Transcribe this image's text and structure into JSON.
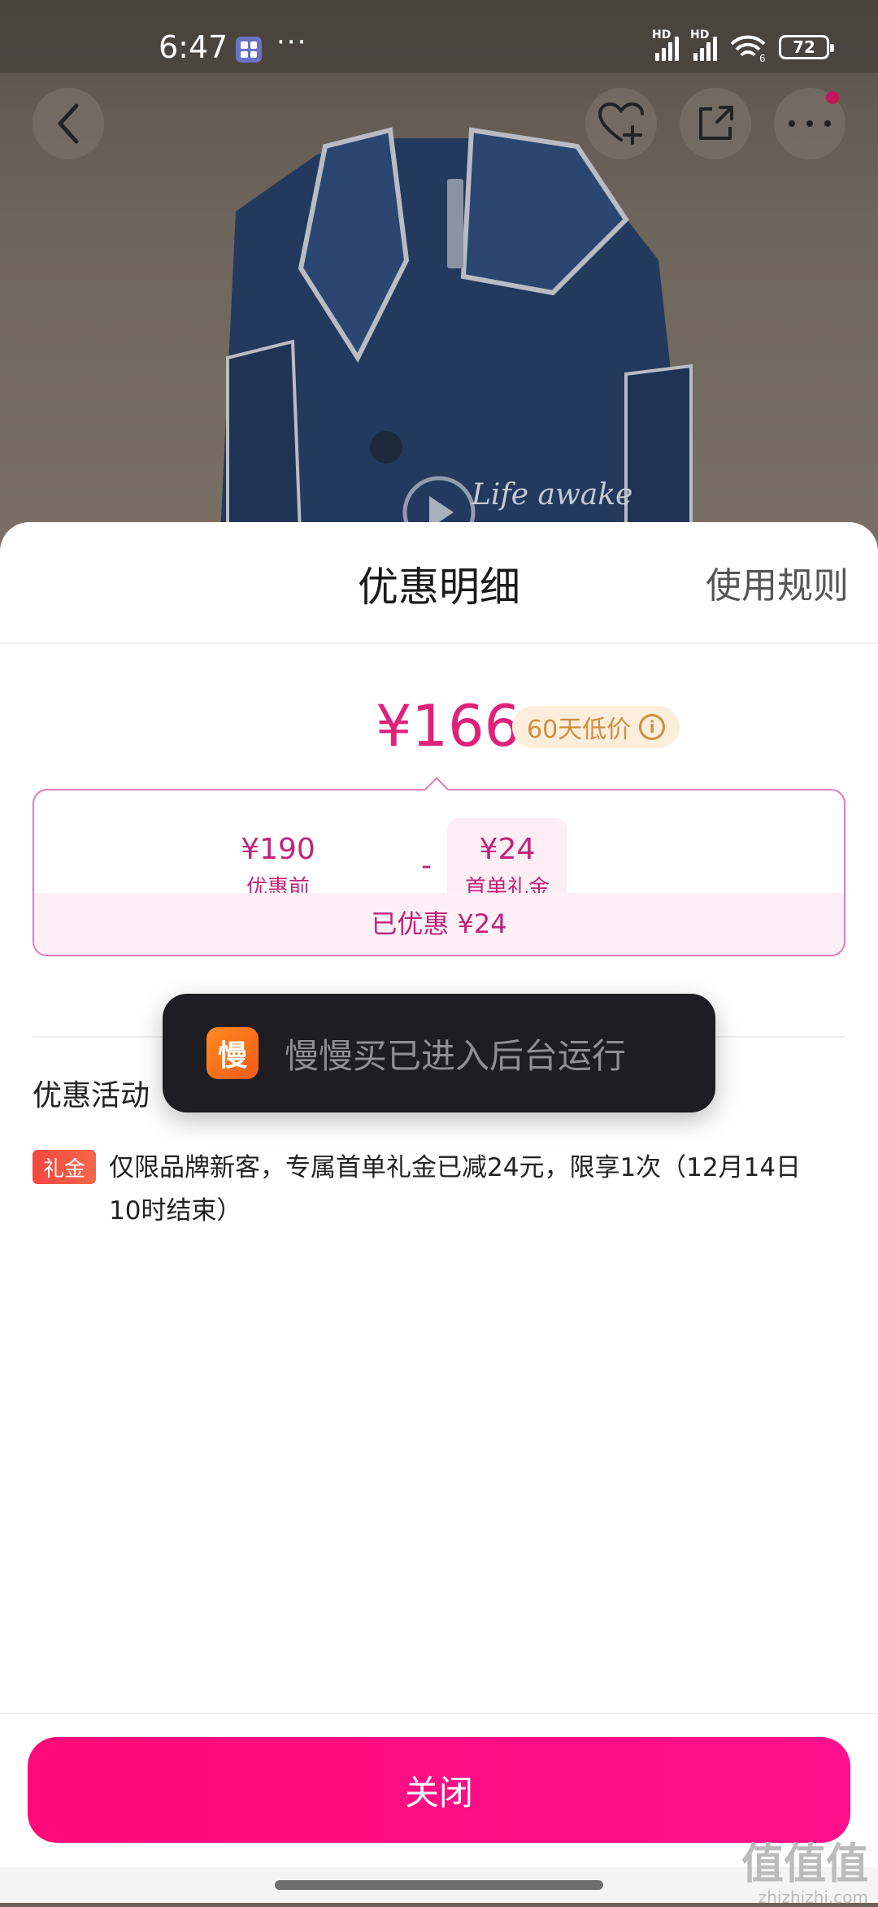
{
  "status_bar": {
    "time": "6:47",
    "more_dots": "···",
    "signal_1_label": "HD",
    "signal_2_label": "HD",
    "wifi_label": "6",
    "battery_level": "72"
  },
  "hero": {
    "embroidery_text": "Life awake"
  },
  "sheet": {
    "title": "优惠明细",
    "rules_link": "使用规则",
    "final_price": "¥166",
    "low_price_badge": "60天低价",
    "breakdown": {
      "before_amount": "¥190",
      "before_label": "优惠前",
      "operator": "-",
      "gift_amount": "¥24",
      "gift_label": "首单礼金",
      "saved_text": "已优惠 ¥24"
    },
    "promo_heading": "优惠活动",
    "promo_tag": "礼金",
    "promo_text": "仅限品牌新客，专属首单礼金已减24元，限享1次（12月14日10时结束）",
    "close_label": "关闭"
  },
  "toast": {
    "icon_char": "慢",
    "message": "慢慢买已进入后台运行"
  },
  "watermark": {
    "logo_text": "值值值",
    "url": "zhizhizhi.com"
  },
  "colors": {
    "accent_pink": "#e0217a",
    "button_pink": "#ff0a7a",
    "badge_orange": "#d08e3e",
    "toast_bg": "#1e1e22"
  }
}
